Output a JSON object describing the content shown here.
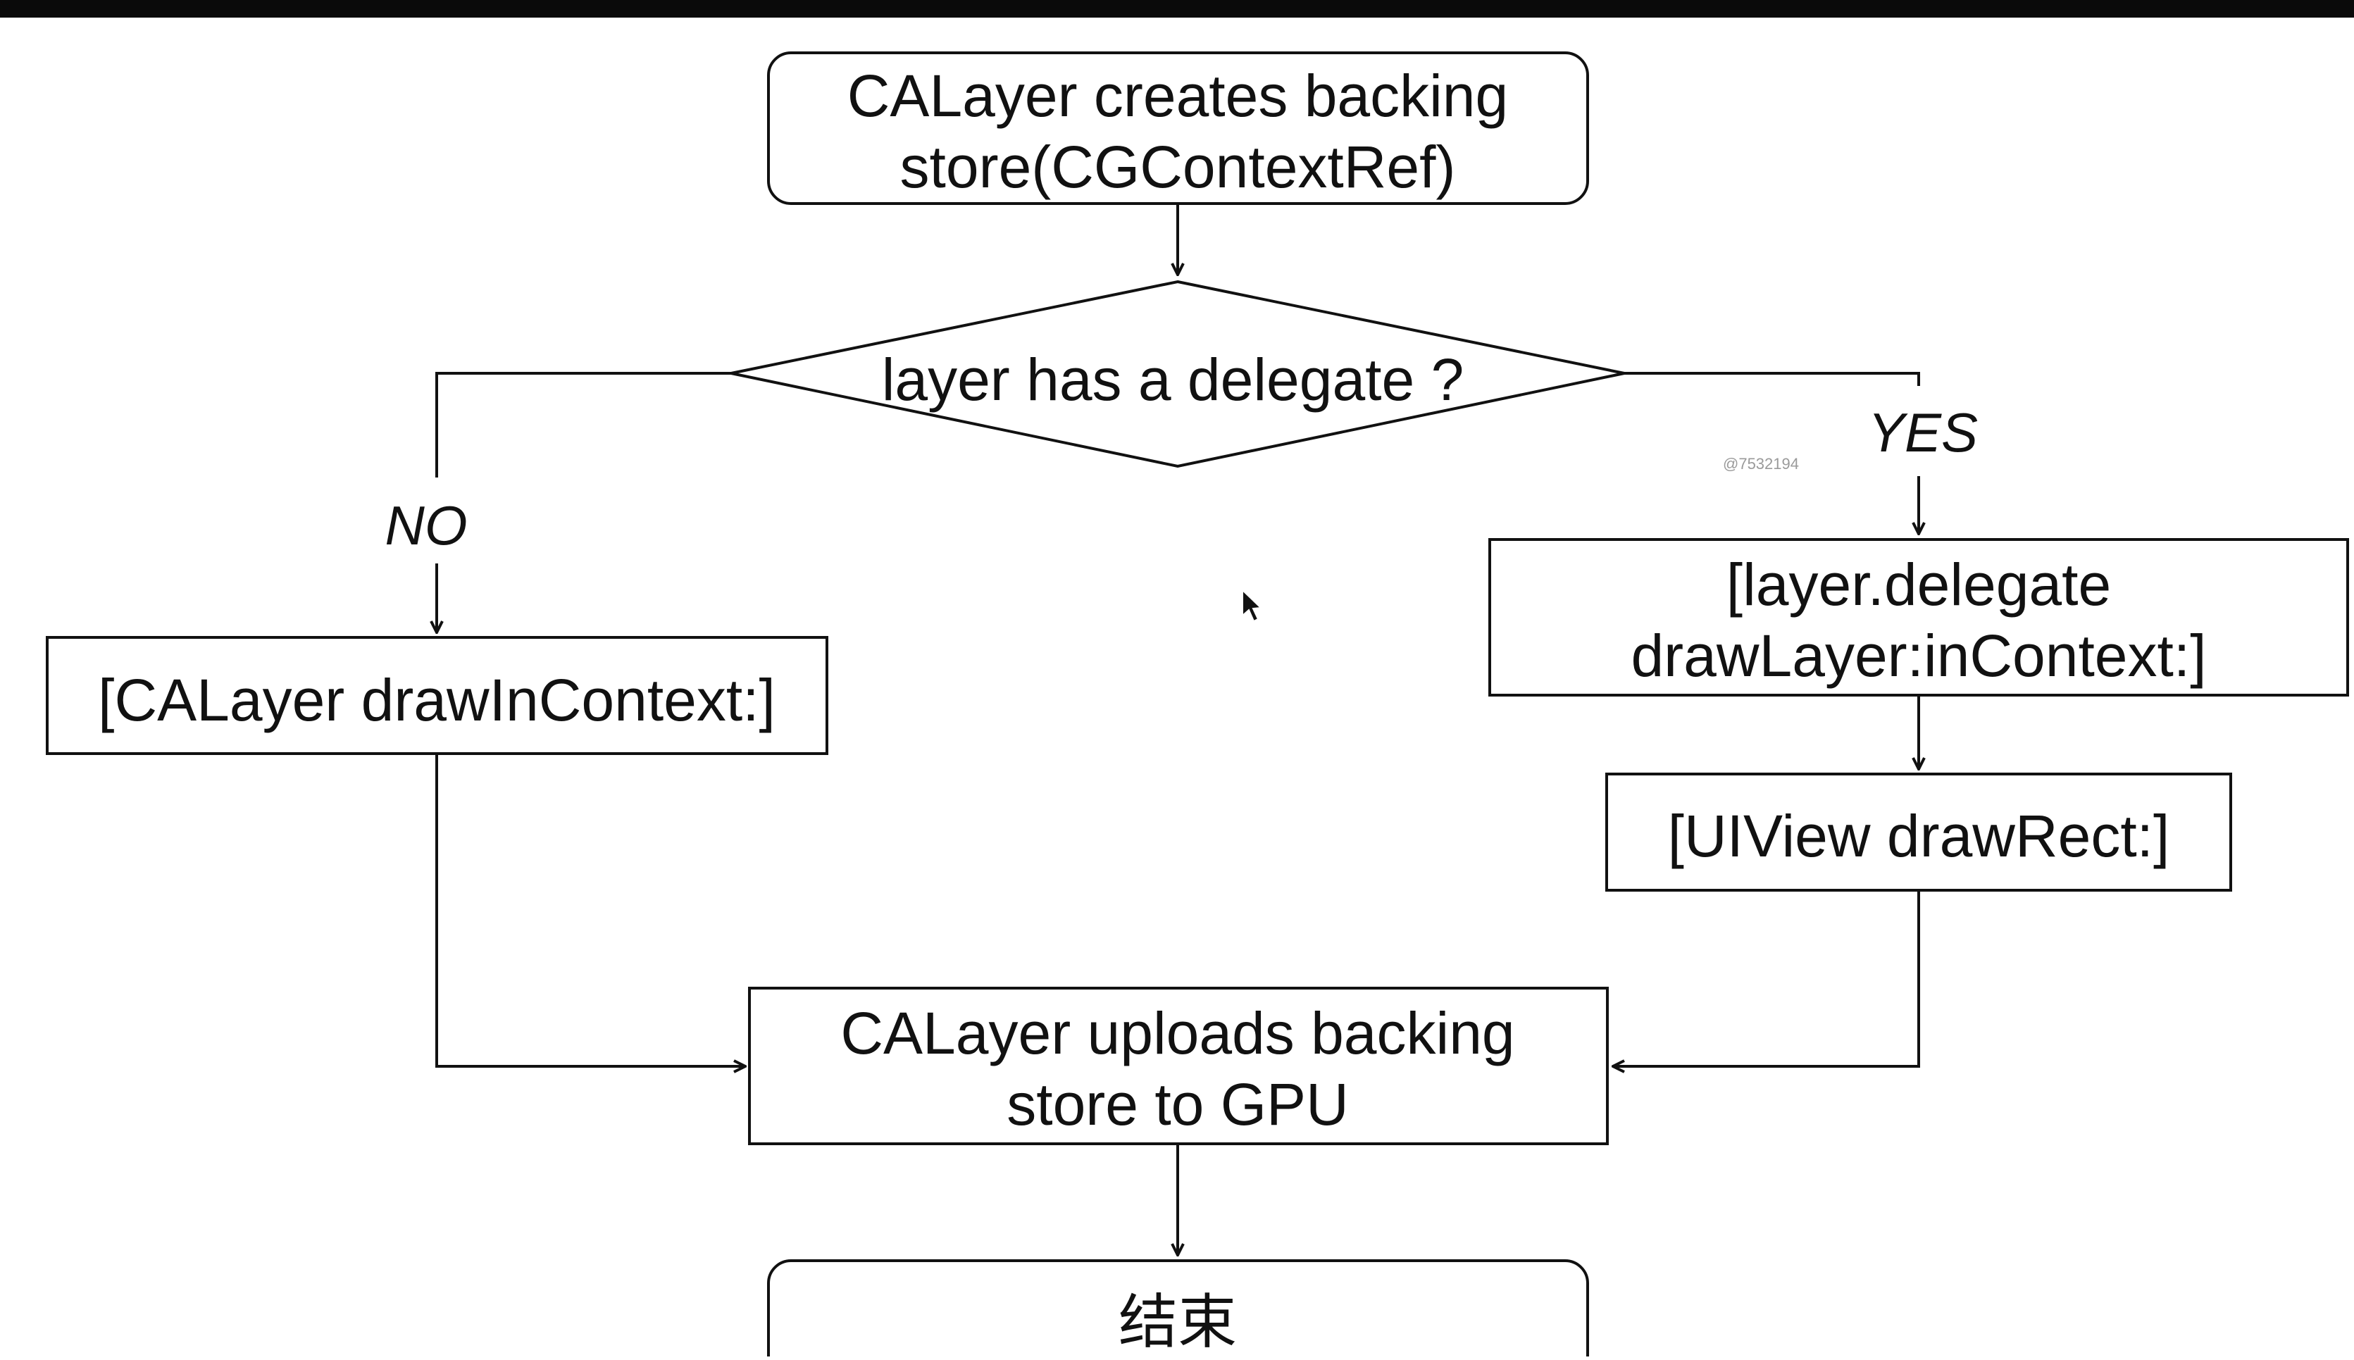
{
  "title_bar": {},
  "diagram": {
    "nodes": {
      "start": {
        "lines": [
          "CALayer creates backing",
          "store(CGContextRef)"
        ]
      },
      "decision": {
        "text": "layer has a delegate ?"
      },
      "no_action": {
        "text": "[CALayer drawInContext:]"
      },
      "yes_action": {
        "lines": [
          "[layer.delegate",
          "drawLayer:inContext:]"
        ]
      },
      "draw_rect": {
        "text": "[UIView drawRect:]"
      },
      "upload": {
        "lines": [
          "CALayer uploads backing",
          "store to GPU"
        ]
      },
      "end": {
        "text": "结束"
      }
    },
    "branch_labels": {
      "no": "NO",
      "yes": "YES"
    },
    "watermark": "@7532194"
  },
  "colors": {
    "line": "#111111",
    "highlight_text": "#a0173f",
    "top_bar": "#0a0a0a",
    "background": "#ffffff"
  }
}
